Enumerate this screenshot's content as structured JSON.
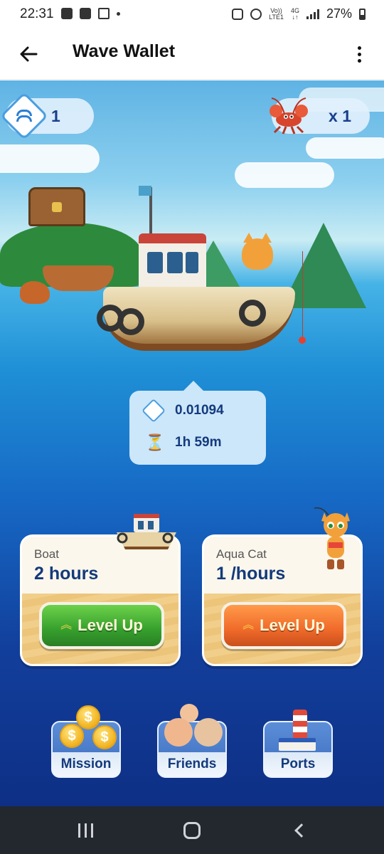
{
  "status_bar": {
    "time": "22:31",
    "network": "4G",
    "volte": "Vo))",
    "lte": "LTE1",
    "battery": "27%"
  },
  "app_bar": {
    "title": "Wave Wallet",
    "back_icon": "arrow-left-icon",
    "menu_icon": "more-vert-icon"
  },
  "resources": {
    "wave_count": "1",
    "lobster_count": "x 1"
  },
  "mining_info": {
    "amount": "0.01094",
    "time_left": "1h 59m"
  },
  "upgrades": [
    {
      "label": "Boat",
      "value": "2 hours",
      "button": "Level Up",
      "color": "#3aa52f"
    },
    {
      "label": "Aqua Cat",
      "value": "1 /hours",
      "button": "Level Up",
      "color": "#f06a2a"
    }
  ],
  "nav": [
    {
      "label": "Mission",
      "icon": "coins-icon"
    },
    {
      "label": "Friends",
      "icon": "friends-icon"
    },
    {
      "label": "Ports",
      "icon": "lighthouse-icon"
    }
  ],
  "colors": {
    "title_text": "#143a7c",
    "accent": "#4a9ee0"
  }
}
